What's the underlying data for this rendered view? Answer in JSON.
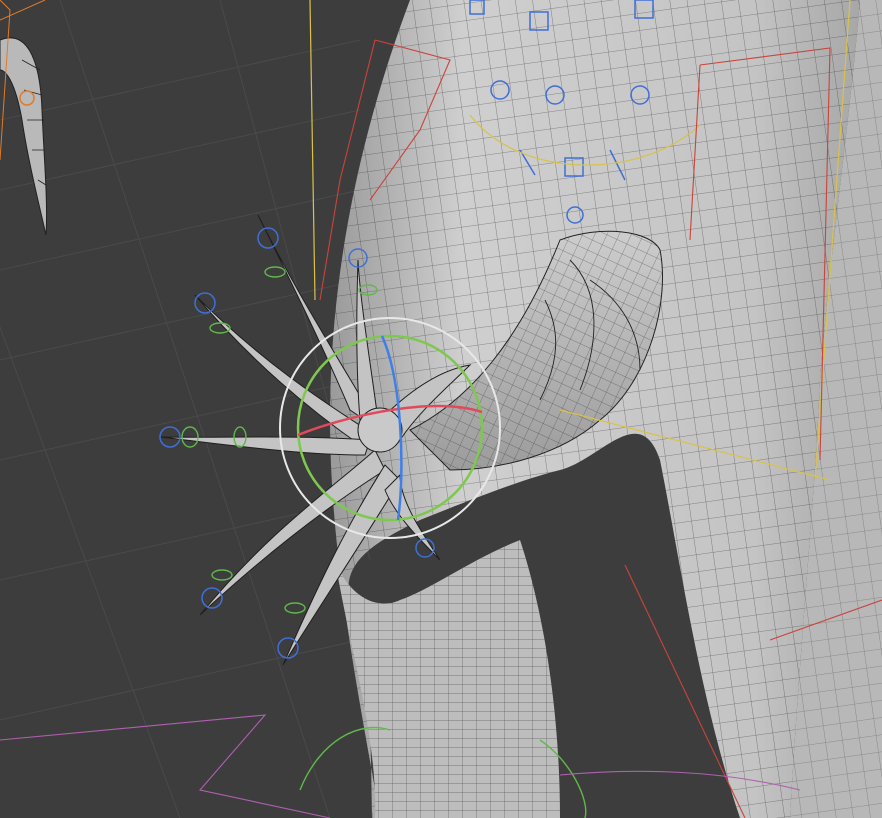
{
  "app": {
    "kind": "3D viewport"
  },
  "viewport": {
    "background": "#3d3d3d",
    "grid_color": "#4a4a4a",
    "mesh_fill": "#c7c7c7",
    "mesh_shadow": "#a8a8a8",
    "wire_color": "#1e1e1e"
  },
  "gizmo": {
    "type": "rotate",
    "x_axis_color": "#e04a5a",
    "y_axis_color": "#7ec850",
    "z_axis_color": "#3f7fe6",
    "view_ring_color": "#e8e8e8"
  },
  "overlays": {
    "bone_ik_color": "#3f6fd6",
    "bone_fk_color": "#5fb84a",
    "constraint_color": "#d8c24a",
    "armature_outline_color": "#c8443c",
    "limit_shape_color": "#b060b0",
    "selected_bone_color": "#e07a2a"
  }
}
